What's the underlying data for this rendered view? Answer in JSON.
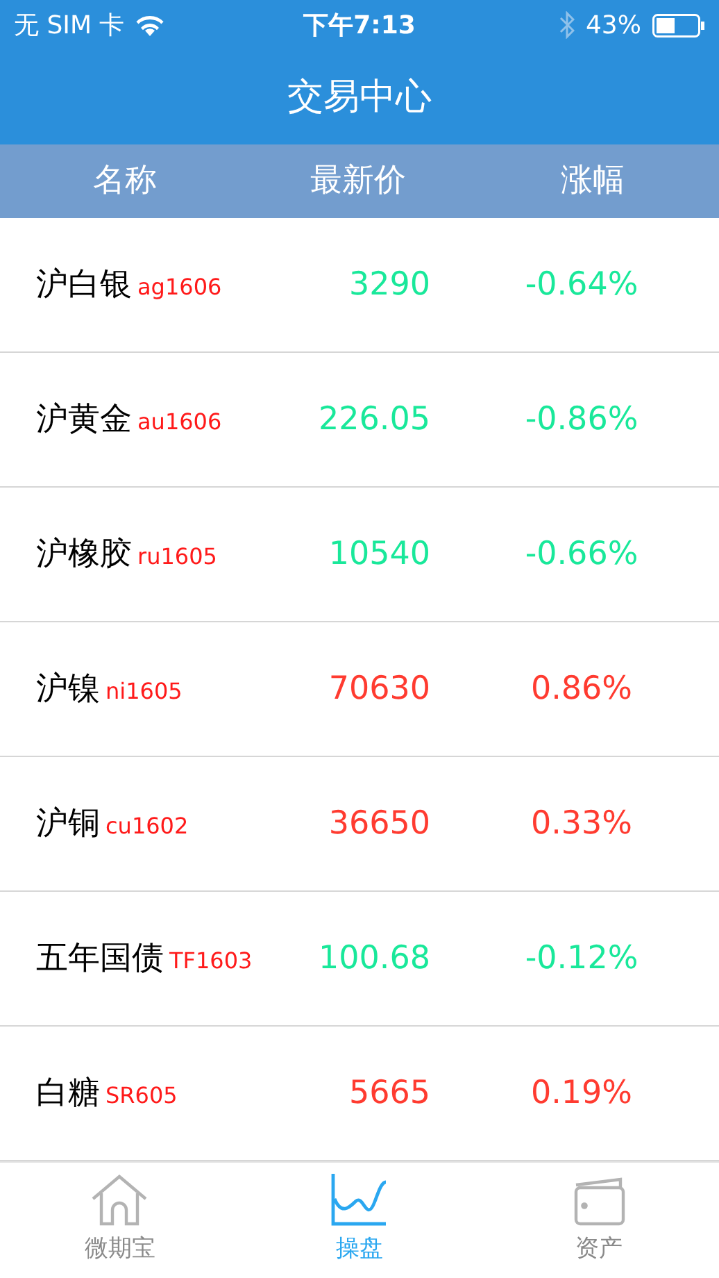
{
  "status_bar": {
    "carrier": "无 SIM 卡",
    "time": "下午7:13",
    "battery": "43%"
  },
  "nav": {
    "title": "交易中心"
  },
  "columns": [
    "名称",
    "最新价",
    "涨幅"
  ],
  "rows": [
    {
      "name": "沪白银",
      "code": "ag1606",
      "price": "3290",
      "change": "-0.64%",
      "color": "#19e89a"
    },
    {
      "name": "沪黄金",
      "code": "au1606",
      "price": "226.05",
      "change": "-0.86%",
      "color": "#19e89a"
    },
    {
      "name": "沪橡胶",
      "code": "ru1605",
      "price": "10540",
      "change": "-0.66%",
      "color": "#19e89a"
    },
    {
      "name": "沪镍",
      "code": "ni1605",
      "price": "70630",
      "change": "0.86%",
      "color": "#ff3b30"
    },
    {
      "name": "沪铜",
      "code": "cu1602",
      "price": "36650",
      "change": "0.33%",
      "color": "#ff3b30"
    },
    {
      "name": "五年国债",
      "code": "TF1603",
      "price": "100.68",
      "change": "-0.12%",
      "color": "#19e89a"
    },
    {
      "name": "白糖",
      "code": "SR605",
      "price": "5665",
      "change": "0.19%",
      "color": "#ff3b30"
    }
  ],
  "tab_bar": [
    {
      "label": "微期宝",
      "kind": "home",
      "selected": false
    },
    {
      "label": "操盘",
      "kind": "chart",
      "selected": true
    },
    {
      "label": "资产",
      "kind": "wallet",
      "selected": false
    }
  ]
}
